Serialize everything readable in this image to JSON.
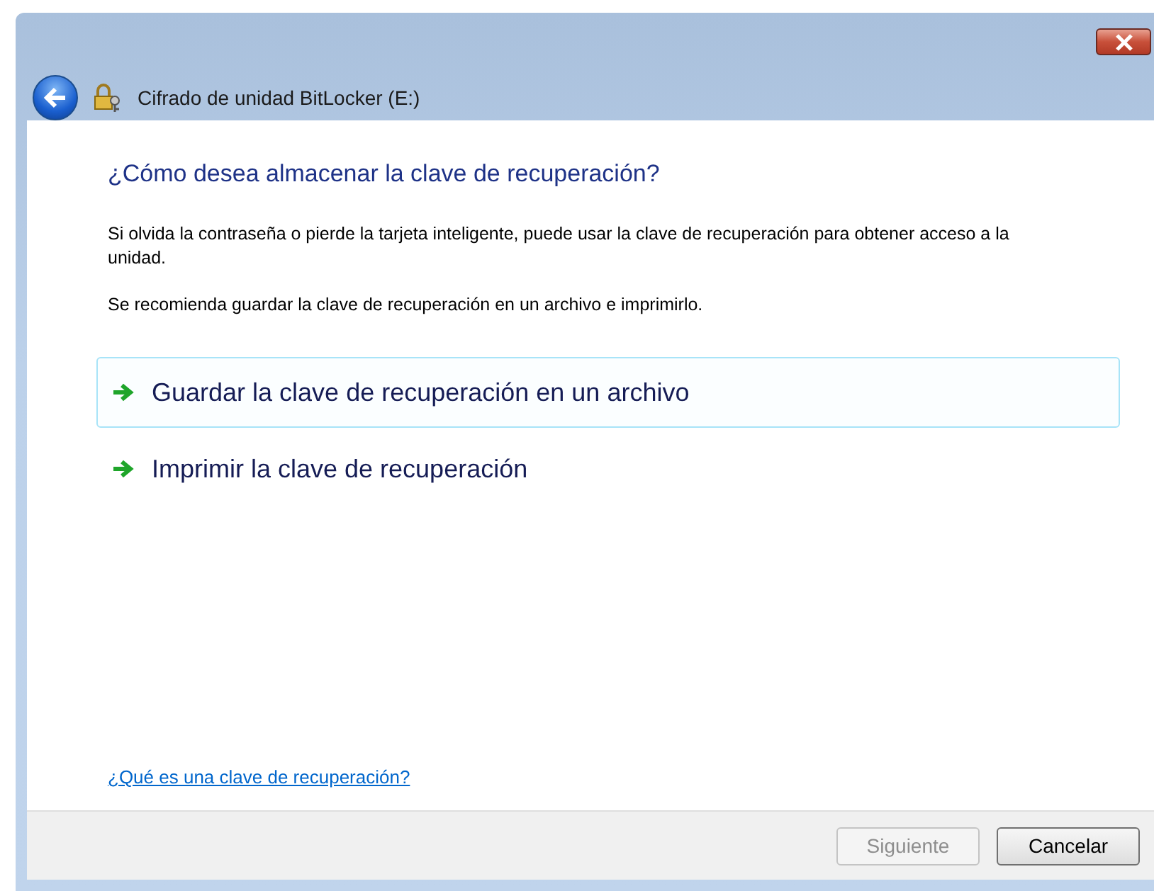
{
  "window": {
    "title": "Cifrado de unidad BitLocker (E:)"
  },
  "heading": "¿Cómo desea almacenar la clave de recuperación?",
  "paragraphs": [
    "Si olvida la contraseña o pierde la tarjeta inteligente, puede usar la clave de recuperación para obtener acceso a la unidad.",
    "Se recomienda guardar la clave de recuperación en un archivo e imprimirlo."
  ],
  "options": [
    {
      "label": "Guardar la clave de recuperación en un archivo",
      "selected": true
    },
    {
      "label": "Imprimir la clave de recuperación",
      "selected": false
    }
  ],
  "help_link": "¿Qué es una clave de recuperación?",
  "buttons": [
    {
      "label": "Siguiente",
      "disabled": true
    },
    {
      "label": "Cancelar",
      "disabled": false
    }
  ]
}
